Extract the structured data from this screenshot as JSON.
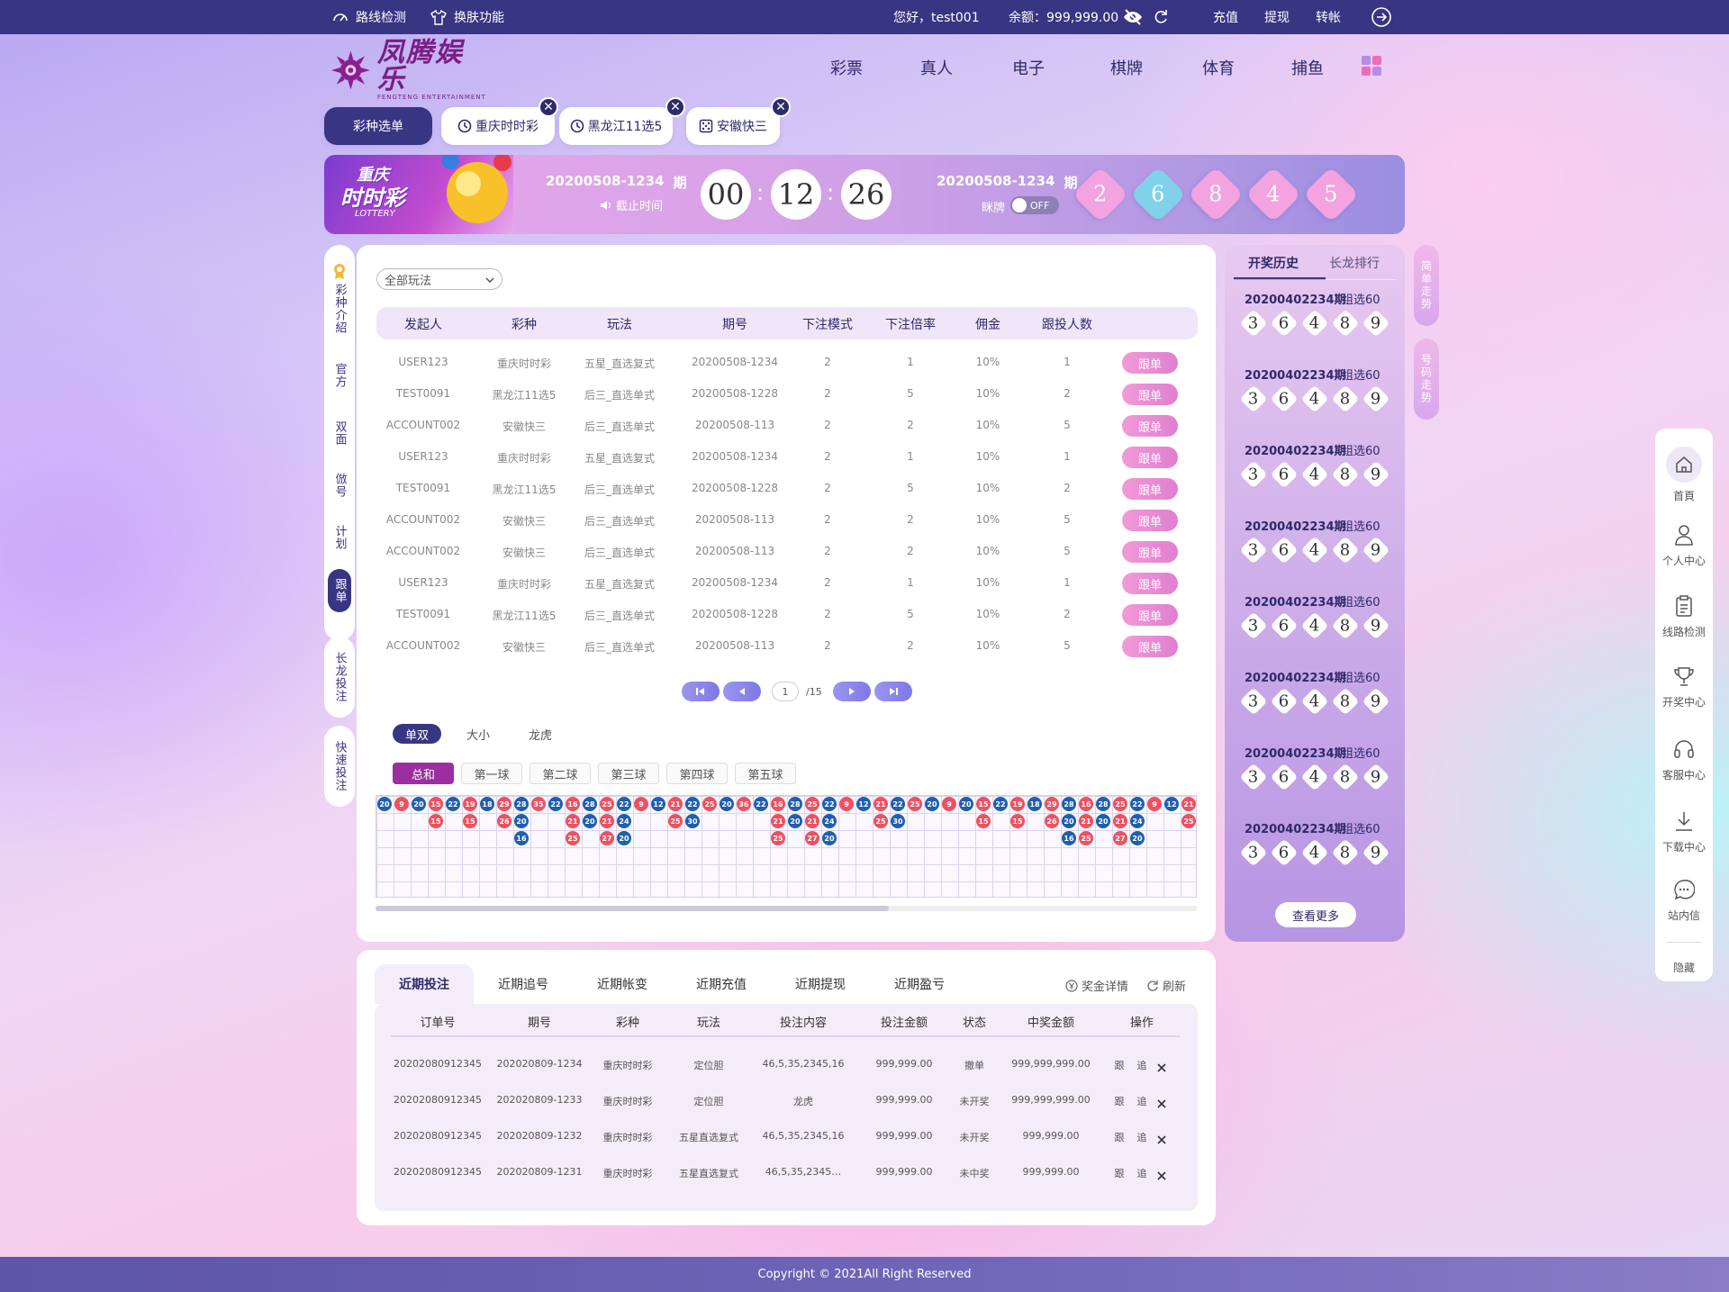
{
  "topbar": {
    "route_check": "路线检测",
    "skin": "换肤功能",
    "greeting": "您好，test001",
    "balance": "余额：999,999.00",
    "deposit": "充值",
    "withdraw": "提现",
    "transfer": "转帐"
  },
  "brand": {
    "logo_cn": "凤腾娱乐",
    "logo_en": "FENGTENG ENTERTAINMENT"
  },
  "nav": [
    "彩票",
    "真人",
    "电子",
    "棋牌",
    "体育",
    "捕鱼"
  ],
  "tabs": {
    "menu": "彩种选单",
    "items": [
      "重庆时时彩",
      "黑龙江11选5",
      "安徽快三"
    ]
  },
  "banner": {
    "logo_line1": "重庆",
    "logo_line2": "时时彩",
    "logo_line3": "LOTTERY",
    "current_issue": "20200508-1234",
    "issue_suffix": "期",
    "deadline_label": "截止时间",
    "timer": [
      "00",
      "12",
      "26"
    ],
    "last_issue": "20200508-1234",
    "last_suffix": "期",
    "peek_label": "眯牌",
    "toggle": "OFF",
    "result": [
      "2",
      "6",
      "8",
      "4",
      "5"
    ],
    "result_colors": [
      "#f2a3e0",
      "#7fd2e9",
      "#f2a3e0",
      "#f2a3e0",
      "#f2a3e0"
    ]
  },
  "sidetabs": [
    "彩种介紹",
    "官方",
    "双面",
    "倣号",
    "计划",
    "跟单"
  ],
  "sidetabs2": [
    "长龙投注",
    "快速投注"
  ],
  "follow": {
    "filter": "全部玩法",
    "headers": [
      "发起人",
      "彩种",
      "玩法",
      "期号",
      "下注模式",
      "下注倍率",
      "佣金",
      "跟投人数"
    ],
    "button": "跟单",
    "rows": [
      [
        "USER123",
        "重庆时时彩",
        "五星_直选复式",
        "20200508-1234",
        "2",
        "1",
        "10%",
        "1"
      ],
      [
        "TEST0091",
        "黑龙江11选5",
        "后三_直选单式",
        "20200508-1228",
        "2",
        "5",
        "10%",
        "2"
      ],
      [
        "ACCOUNT002",
        "安徽快三",
        "后三_直选单式",
        "20200508-113",
        "2",
        "2",
        "10%",
        "5"
      ],
      [
        "USER123",
        "重庆时时彩",
        "五星_直选复式",
        "20200508-1234",
        "2",
        "1",
        "10%",
        "1"
      ],
      [
        "TEST0091",
        "黑龙江11选5",
        "后三_直选单式",
        "20200508-1228",
        "2",
        "5",
        "10%",
        "2"
      ],
      [
        "ACCOUNT002",
        "安徽快三",
        "后三_直选单式",
        "20200508-113",
        "2",
        "2",
        "10%",
        "5"
      ],
      [
        "ACCOUNT002",
        "安徽快三",
        "后三_直选单式",
        "20200508-113",
        "2",
        "2",
        "10%",
        "5"
      ],
      [
        "USER123",
        "重庆时时彩",
        "五星_直选复式",
        "20200508-1234",
        "2",
        "1",
        "10%",
        "1"
      ],
      [
        "TEST0091",
        "黑龙江11选5",
        "后三_直选单式",
        "20200508-1228",
        "2",
        "5",
        "10%",
        "2"
      ],
      [
        "ACCOUNT002",
        "安徽快三",
        "后三_直选单式",
        "20200508-113",
        "2",
        "2",
        "10%",
        "5"
      ]
    ],
    "page_current": "1",
    "page_total": "/15"
  },
  "trend": {
    "toggles": [
      "单双",
      "大小",
      "龙虎"
    ],
    "balls": [
      "总和",
      "第一球",
      "第二球",
      "第三球",
      "第四球",
      "第五球"
    ],
    "red": "#f0505f",
    "blue": "#1f5fb0",
    "columns": [
      {
        "c": "b",
        "v": [
          "20"
        ]
      },
      {
        "c": "r",
        "v": [
          "9"
        ]
      },
      {
        "c": "b",
        "v": [
          "20"
        ]
      },
      {
        "c": "r",
        "v": [
          "15",
          "15"
        ]
      },
      {
        "c": "b",
        "v": [
          "22"
        ]
      },
      {
        "c": "r",
        "v": [
          "19",
          "15"
        ]
      },
      {
        "c": "b",
        "v": [
          "18"
        ]
      },
      {
        "c": "r",
        "v": [
          "29",
          "26"
        ]
      },
      {
        "c": "b",
        "v": [
          "28",
          "20",
          "16"
        ]
      },
      {
        "c": "r",
        "v": [
          "35"
        ]
      },
      {
        "c": "b",
        "v": [
          "22"
        ]
      },
      {
        "c": "r",
        "v": [
          "16",
          "21",
          "25"
        ]
      },
      {
        "c": "b",
        "v": [
          "28",
          "20"
        ]
      },
      {
        "c": "r",
        "v": [
          "25",
          "21",
          "27"
        ]
      },
      {
        "c": "b",
        "v": [
          "22",
          "24",
          "20"
        ]
      },
      {
        "c": "r",
        "v": [
          "9"
        ]
      },
      {
        "c": "b",
        "v": [
          "12"
        ]
      },
      {
        "c": "r",
        "v": [
          "21",
          "25"
        ]
      },
      {
        "c": "b",
        "v": [
          "22",
          "30"
        ]
      },
      {
        "c": "r",
        "v": [
          "25"
        ]
      },
      {
        "c": "b",
        "v": [
          "20"
        ]
      },
      {
        "c": "r",
        "v": [
          "36"
        ]
      },
      {
        "c": "b",
        "v": [
          "22"
        ]
      },
      {
        "c": "r",
        "v": [
          "16",
          "21",
          "25"
        ]
      },
      {
        "c": "b",
        "v": [
          "28",
          "20"
        ]
      },
      {
        "c": "r",
        "v": [
          "25",
          "21",
          "27"
        ]
      },
      {
        "c": "b",
        "v": [
          "22",
          "24",
          "20"
        ]
      },
      {
        "c": "r",
        "v": [
          "9"
        ]
      },
      {
        "c": "b",
        "v": [
          "12"
        ]
      },
      {
        "c": "r",
        "v": [
          "21",
          "25"
        ]
      },
      {
        "c": "b",
        "v": [
          "22",
          "30"
        ]
      },
      {
        "c": "r",
        "v": [
          "25"
        ]
      },
      {
        "c": "b",
        "v": [
          "20"
        ]
      },
      {
        "c": "r",
        "v": [
          "9"
        ]
      },
      {
        "c": "b",
        "v": [
          "20"
        ]
      },
      {
        "c": "r",
        "v": [
          "15",
          "15"
        ]
      },
      {
        "c": "b",
        "v": [
          "22"
        ]
      },
      {
        "c": "r",
        "v": [
          "19",
          "15"
        ]
      },
      {
        "c": "b",
        "v": [
          "18"
        ]
      },
      {
        "c": "r",
        "v": [
          "29",
          "26"
        ]
      },
      {
        "c": "b",
        "v": [
          "28",
          "20",
          "16"
        ]
      },
      {
        "c": "r",
        "v": [
          "16",
          "21",
          "25"
        ]
      },
      {
        "c": "b",
        "v": [
          "28",
          "20"
        ]
      },
      {
        "c": "r",
        "v": [
          "25",
          "21",
          "27"
        ]
      },
      {
        "c": "b",
        "v": [
          "22",
          "24",
          "20"
        ]
      },
      {
        "c": "r",
        "v": [
          "9"
        ]
      },
      {
        "c": "b",
        "v": [
          "12"
        ]
      },
      {
        "c": "r",
        "v": [
          "21",
          "25"
        ]
      }
    ]
  },
  "history": {
    "tabs": [
      "开奖历史",
      "长龙排行"
    ],
    "side_pills": [
      "简单走势",
      "号码走势"
    ],
    "issue": "20200402234期",
    "tag": "组选60",
    "balls": [
      "3",
      "6",
      "4",
      "8",
      "9"
    ],
    "count": 8,
    "more": "查看更多"
  },
  "dock": [
    "首頁",
    "个人中心",
    "线路检测",
    "开奖中心",
    "客服中心",
    "下载中心",
    "站内信",
    "隐藏"
  ],
  "records": {
    "tabs": [
      "近期投注",
      "近期追号",
      "近期帐变",
      "近期充值",
      "近期提现",
      "近期盈亏"
    ],
    "bonus": "奖金详情",
    "refresh": "刷新",
    "headers": [
      "订单号",
      "期号",
      "彩种",
      "玩法",
      "投注内容",
      "投注金额",
      "状态",
      "中奖金额",
      "操作"
    ],
    "act_follow": "跟",
    "act_chase": "追",
    "rows": [
      [
        "20202080912345",
        "202020809-1234",
        "重庆时时彩",
        "定位胆",
        "46,5,35,2345,16",
        "999,999.00",
        "撤单",
        "999,999,999.00"
      ],
      [
        "20202080912345",
        "202020809-1233",
        "重庆时时彩",
        "定位胆",
        "龙虎",
        "999,999.00",
        "未开奖",
        "999,999,999.00"
      ],
      [
        "20202080912345",
        "202020809-1232",
        "重庆时时彩",
        "五星直选复式",
        "46,5,35,2345,16",
        "999,999.00",
        "未开奖",
        "999,999.00"
      ],
      [
        "20202080912345",
        "202020809-1231",
        "重庆时时彩",
        "五星直选复式",
        "46,5,35,2345…",
        "999,999.00",
        "未中奖",
        "999,999.00"
      ]
    ]
  },
  "footer": "Copyright © 2021All Right Reserved"
}
